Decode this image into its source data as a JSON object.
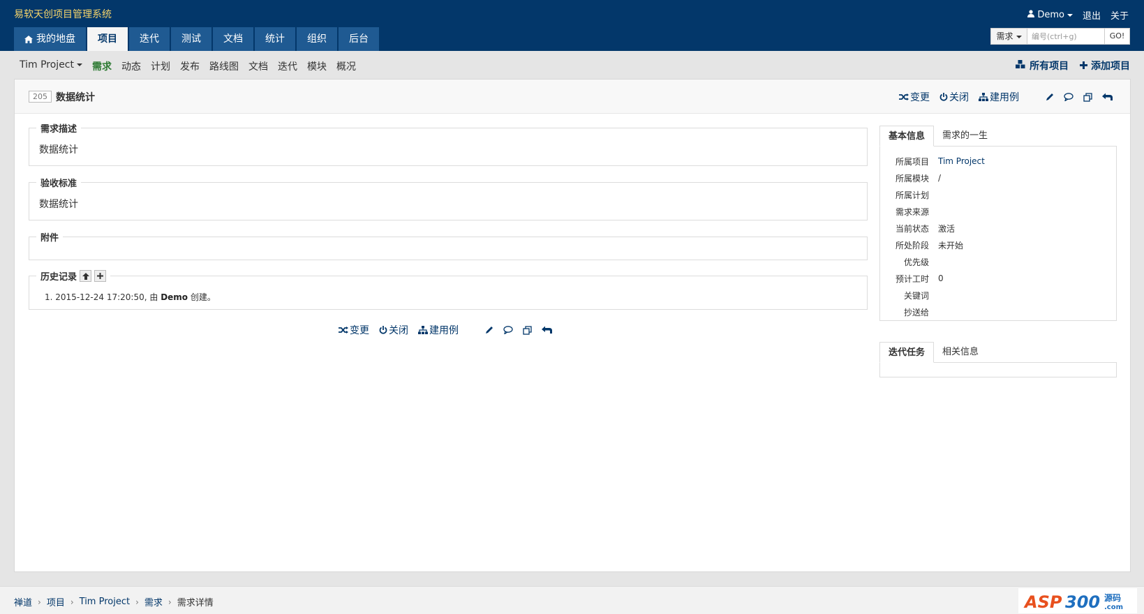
{
  "app": {
    "title": "易软天创项目管理系统"
  },
  "user_links": {
    "user": "Demo",
    "logout": "退出",
    "about": "关于"
  },
  "main_nav": [
    {
      "label": "我的地盘",
      "icon": "home-icon"
    },
    {
      "label": "项目"
    },
    {
      "label": "迭代"
    },
    {
      "label": "测试"
    },
    {
      "label": "文档"
    },
    {
      "label": "统计"
    },
    {
      "label": "组织"
    },
    {
      "label": "后台"
    }
  ],
  "search": {
    "type": "需求",
    "placeholder": "编号(ctrl+g)",
    "go": "GO!"
  },
  "subnav": {
    "project": "Tim Project",
    "items": [
      "需求",
      "动态",
      "计划",
      "发布",
      "路线图",
      "文档",
      "迭代",
      "模块",
      "概况"
    ],
    "all_projects": "所有项目",
    "add_project": "添加项目"
  },
  "story": {
    "id": "205",
    "title": "数据统计"
  },
  "actions": {
    "change": "变更",
    "close": "关闭",
    "build_case": "建用例"
  },
  "sections": {
    "description": {
      "legend": "需求描述",
      "content": "数据统计"
    },
    "acceptance": {
      "legend": "验收标准",
      "content": "数据统计"
    },
    "attachments": {
      "legend": "附件"
    },
    "history": {
      "legend": "历史记录",
      "entry_num": "1.",
      "entry_time": "2015-12-24 17:20:50, 由 ",
      "entry_user": "Demo",
      "entry_action": " 创建。"
    }
  },
  "basic_info": {
    "tabs": [
      "基本信息",
      "需求的一生"
    ],
    "rows": [
      {
        "k": "所属项目",
        "v": "Tim Project"
      },
      {
        "k": "所属模块",
        "v": "/"
      },
      {
        "k": "所属计划",
        "v": ""
      },
      {
        "k": "需求来源",
        "v": ""
      },
      {
        "k": "当前状态",
        "v": "激活"
      },
      {
        "k": "所处阶段",
        "v": "未开始"
      },
      {
        "k": "优先级",
        "v": ""
      },
      {
        "k": "预计工时",
        "v": "0"
      },
      {
        "k": "关键词",
        "v": ""
      },
      {
        "k": "抄送给",
        "v": ""
      }
    ]
  },
  "related": {
    "tabs": [
      "迭代任务",
      "相关信息"
    ]
  },
  "breadcrumb": [
    "禅道",
    "项目",
    "Tim Project",
    "需求",
    "需求详情"
  ],
  "watermark": "ASP300 源码 .com",
  "colors": {
    "topbar": "#03376a",
    "title": "#f5d36a",
    "active_sub": "#2d7a33"
  }
}
